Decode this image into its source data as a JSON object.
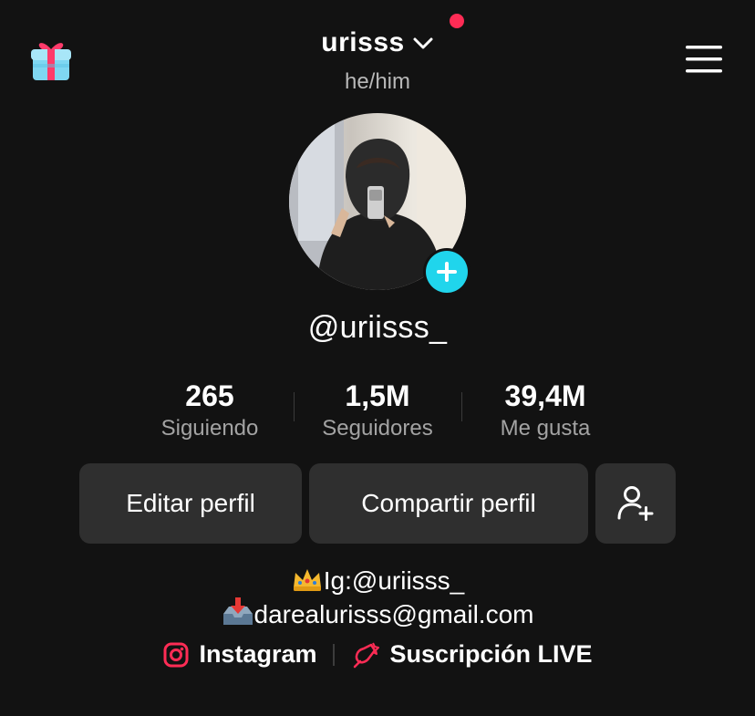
{
  "header": {
    "username": "urisss",
    "pronouns": "he/him",
    "gift_icon": "gift-icon",
    "menu_icon": "hamburger-menu-icon"
  },
  "profile": {
    "handle": "@uriisss_",
    "stats": [
      {
        "value": "265",
        "label": "Siguiendo"
      },
      {
        "value": "1,5M",
        "label": "Seguidores"
      },
      {
        "value": "39,4M",
        "label": "Me gusta"
      }
    ]
  },
  "actions": {
    "edit_label": "Editar perfil",
    "share_label": "Compartir perfil",
    "add_friend_icon": "add-friend-icon"
  },
  "bio": {
    "line1": "Ig:@uriisss_",
    "line2": "darealurisss@gmail.com"
  },
  "links": {
    "instagram_label": "Instagram",
    "live_label": "Suscripción LIVE"
  },
  "colors": {
    "background": "#121212",
    "accent_red": "#fe2c55",
    "accent_cyan": "#20d5ec",
    "button_bg": "#2f2f2f"
  }
}
